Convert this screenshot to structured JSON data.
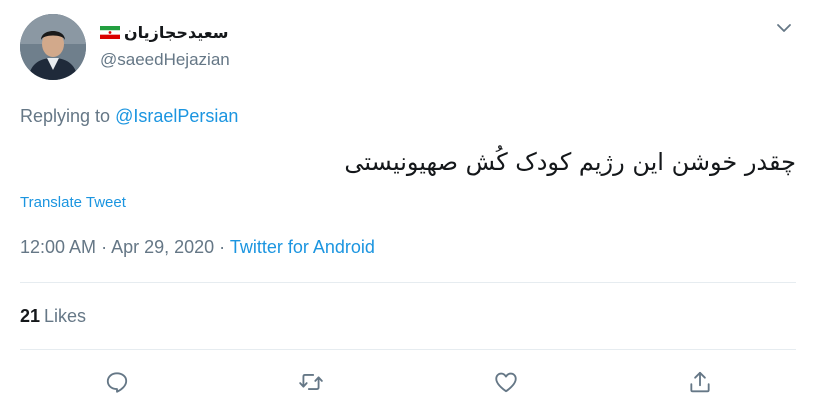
{
  "author": {
    "display_name": "سعیدحجازیان",
    "handle": "@saeedHejazian",
    "flag": "iran-flag"
  },
  "reply_context": {
    "prefix": "Replying to",
    "mention": "@IsraelPersian"
  },
  "tweet": {
    "text": "چقدر خوشن این رژیم کودک کُش صهیونیستی",
    "translate_label": "Translate Tweet"
  },
  "meta": {
    "time": "12:00 AM",
    "separator1": " · ",
    "date": "Apr 29, 2020",
    "separator2": " · ",
    "source": "Twitter for Android"
  },
  "stats": {
    "likes_count": "21",
    "likes_label": "Likes"
  },
  "actions": {
    "reply_icon": "reply-icon",
    "retweet_icon": "retweet-icon",
    "like_icon": "heart-icon",
    "share_icon": "share-icon"
  },
  "colors": {
    "link": "#1b95e0",
    "muted": "#657786",
    "text": "#14171a",
    "divider": "#e6ecf0"
  }
}
